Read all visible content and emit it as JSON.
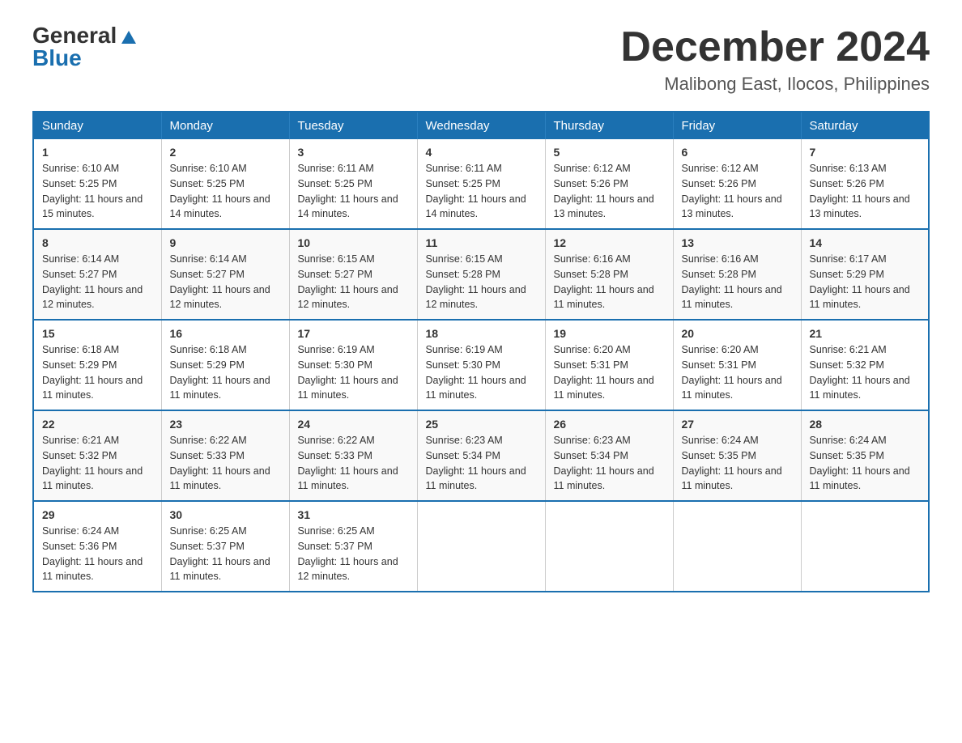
{
  "logo": {
    "general": "General",
    "blue": "Blue"
  },
  "title": "December 2024",
  "location": "Malibong East, Ilocos, Philippines",
  "days_of_week": [
    "Sunday",
    "Monday",
    "Tuesday",
    "Wednesday",
    "Thursday",
    "Friday",
    "Saturday"
  ],
  "weeks": [
    [
      {
        "day": "1",
        "sunrise": "6:10 AM",
        "sunset": "5:25 PM",
        "daylight": "11 hours and 15 minutes."
      },
      {
        "day": "2",
        "sunrise": "6:10 AM",
        "sunset": "5:25 PM",
        "daylight": "11 hours and 14 minutes."
      },
      {
        "day": "3",
        "sunrise": "6:11 AM",
        "sunset": "5:25 PM",
        "daylight": "11 hours and 14 minutes."
      },
      {
        "day": "4",
        "sunrise": "6:11 AM",
        "sunset": "5:25 PM",
        "daylight": "11 hours and 14 minutes."
      },
      {
        "day": "5",
        "sunrise": "6:12 AM",
        "sunset": "5:26 PM",
        "daylight": "11 hours and 13 minutes."
      },
      {
        "day": "6",
        "sunrise": "6:12 AM",
        "sunset": "5:26 PM",
        "daylight": "11 hours and 13 minutes."
      },
      {
        "day": "7",
        "sunrise": "6:13 AM",
        "sunset": "5:26 PM",
        "daylight": "11 hours and 13 minutes."
      }
    ],
    [
      {
        "day": "8",
        "sunrise": "6:14 AM",
        "sunset": "5:27 PM",
        "daylight": "11 hours and 12 minutes."
      },
      {
        "day": "9",
        "sunrise": "6:14 AM",
        "sunset": "5:27 PM",
        "daylight": "11 hours and 12 minutes."
      },
      {
        "day": "10",
        "sunrise": "6:15 AM",
        "sunset": "5:27 PM",
        "daylight": "11 hours and 12 minutes."
      },
      {
        "day": "11",
        "sunrise": "6:15 AM",
        "sunset": "5:28 PM",
        "daylight": "11 hours and 12 minutes."
      },
      {
        "day": "12",
        "sunrise": "6:16 AM",
        "sunset": "5:28 PM",
        "daylight": "11 hours and 11 minutes."
      },
      {
        "day": "13",
        "sunrise": "6:16 AM",
        "sunset": "5:28 PM",
        "daylight": "11 hours and 11 minutes."
      },
      {
        "day": "14",
        "sunrise": "6:17 AM",
        "sunset": "5:29 PM",
        "daylight": "11 hours and 11 minutes."
      }
    ],
    [
      {
        "day": "15",
        "sunrise": "6:18 AM",
        "sunset": "5:29 PM",
        "daylight": "11 hours and 11 minutes."
      },
      {
        "day": "16",
        "sunrise": "6:18 AM",
        "sunset": "5:29 PM",
        "daylight": "11 hours and 11 minutes."
      },
      {
        "day": "17",
        "sunrise": "6:19 AM",
        "sunset": "5:30 PM",
        "daylight": "11 hours and 11 minutes."
      },
      {
        "day": "18",
        "sunrise": "6:19 AM",
        "sunset": "5:30 PM",
        "daylight": "11 hours and 11 minutes."
      },
      {
        "day": "19",
        "sunrise": "6:20 AM",
        "sunset": "5:31 PM",
        "daylight": "11 hours and 11 minutes."
      },
      {
        "day": "20",
        "sunrise": "6:20 AM",
        "sunset": "5:31 PM",
        "daylight": "11 hours and 11 minutes."
      },
      {
        "day": "21",
        "sunrise": "6:21 AM",
        "sunset": "5:32 PM",
        "daylight": "11 hours and 11 minutes."
      }
    ],
    [
      {
        "day": "22",
        "sunrise": "6:21 AM",
        "sunset": "5:32 PM",
        "daylight": "11 hours and 11 minutes."
      },
      {
        "day": "23",
        "sunrise": "6:22 AM",
        "sunset": "5:33 PM",
        "daylight": "11 hours and 11 minutes."
      },
      {
        "day": "24",
        "sunrise": "6:22 AM",
        "sunset": "5:33 PM",
        "daylight": "11 hours and 11 minutes."
      },
      {
        "day": "25",
        "sunrise": "6:23 AM",
        "sunset": "5:34 PM",
        "daylight": "11 hours and 11 minutes."
      },
      {
        "day": "26",
        "sunrise": "6:23 AM",
        "sunset": "5:34 PM",
        "daylight": "11 hours and 11 minutes."
      },
      {
        "day": "27",
        "sunrise": "6:24 AM",
        "sunset": "5:35 PM",
        "daylight": "11 hours and 11 minutes."
      },
      {
        "day": "28",
        "sunrise": "6:24 AM",
        "sunset": "5:35 PM",
        "daylight": "11 hours and 11 minutes."
      }
    ],
    [
      {
        "day": "29",
        "sunrise": "6:24 AM",
        "sunset": "5:36 PM",
        "daylight": "11 hours and 11 minutes."
      },
      {
        "day": "30",
        "sunrise": "6:25 AM",
        "sunset": "5:37 PM",
        "daylight": "11 hours and 11 minutes."
      },
      {
        "day": "31",
        "sunrise": "6:25 AM",
        "sunset": "5:37 PM",
        "daylight": "11 hours and 12 minutes."
      },
      null,
      null,
      null,
      null
    ]
  ]
}
